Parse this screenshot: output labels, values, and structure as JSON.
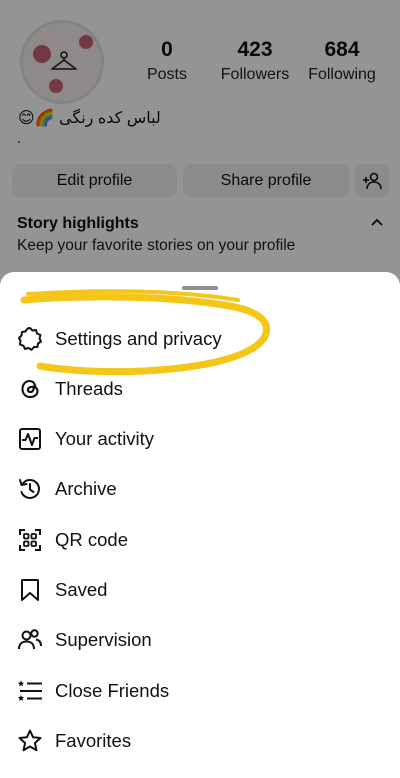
{
  "profile": {
    "stats": [
      {
        "value": "0",
        "label": "Posts"
      },
      {
        "value": "423",
        "label": "Followers"
      },
      {
        "value": "684",
        "label": "Following"
      }
    ],
    "bio_name": "لباس کده رنگی 🌈😊",
    "bio_line2": ".",
    "edit_button": "Edit profile",
    "share_button": "Share profile",
    "highlights_title": "Story highlights",
    "highlights_subtitle": "Keep your favorite stories on your profile"
  },
  "menu": {
    "items": [
      {
        "label": "Settings and privacy",
        "icon": "gear-icon"
      },
      {
        "label": "Threads",
        "icon": "threads-icon"
      },
      {
        "label": "Your activity",
        "icon": "activity-icon"
      },
      {
        "label": "Archive",
        "icon": "archive-icon"
      },
      {
        "label": "QR code",
        "icon": "qr-code-icon"
      },
      {
        "label": "Saved",
        "icon": "bookmark-icon"
      },
      {
        "label": "Supervision",
        "icon": "supervision-icon"
      },
      {
        "label": "Close Friends",
        "icon": "close-friends-icon"
      },
      {
        "label": "Favorites",
        "icon": "star-icon"
      }
    ]
  },
  "colors": {
    "highlight_stroke": "#f5c518",
    "dim_overlay": "rgba(0,0,0,0.42)"
  }
}
